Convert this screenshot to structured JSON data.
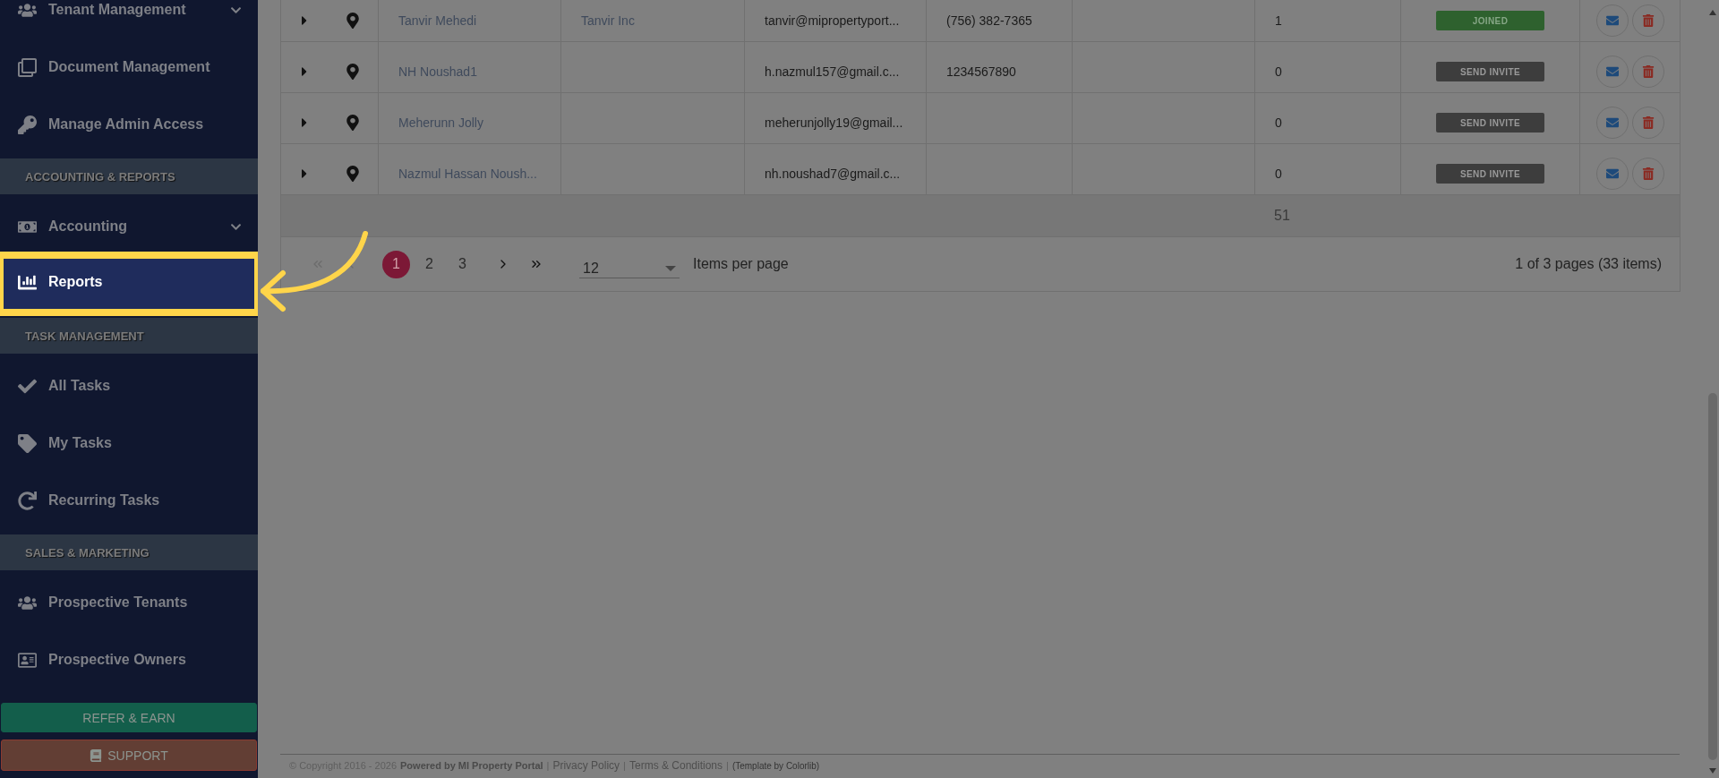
{
  "sidebar": {
    "items": [
      {
        "kind": "link",
        "label": "Tenant Management",
        "expandable": true,
        "selected": false
      },
      {
        "kind": "link",
        "label": "Document Management",
        "expandable": false,
        "selected": false
      },
      {
        "kind": "link",
        "label": "Manage Admin Access",
        "expandable": false,
        "selected": false
      },
      {
        "kind": "section",
        "label": "ACCOUNTING & REPORTS"
      },
      {
        "kind": "link",
        "label": "Accounting",
        "expandable": true,
        "selected": false
      },
      {
        "kind": "link",
        "label": "Reports",
        "expandable": false,
        "selected": true
      },
      {
        "kind": "section",
        "label": "TASK MANAGEMENT"
      },
      {
        "kind": "link",
        "label": "All Tasks",
        "expandable": false,
        "selected": false
      },
      {
        "kind": "link",
        "label": "My Tasks",
        "expandable": false,
        "selected": false
      },
      {
        "kind": "link",
        "label": "Recurring Tasks",
        "expandable": false,
        "selected": false
      },
      {
        "kind": "section",
        "label": "SALES & MARKETING"
      },
      {
        "kind": "link",
        "label": "Prospective Tenants",
        "expandable": false,
        "selected": false
      },
      {
        "kind": "link",
        "label": "Prospective Owners",
        "expandable": false,
        "selected": false
      }
    ],
    "refer_button": "REFER & EARN",
    "support_button": "SUPPORT"
  },
  "table": {
    "rows": [
      {
        "name": "Tanvir Mehedi",
        "company": "Tanvir Inc",
        "email": "tanvir@mipropertyport...",
        "phone": "(756) 382-7365",
        "count": "1",
        "status": {
          "kind": "joined",
          "label": "JOINED"
        }
      },
      {
        "name": "NH Noushad1",
        "company": "",
        "email": "h.nazmul157@gmail.c...",
        "phone": "1234567890",
        "count": "0",
        "status": {
          "kind": "invite",
          "label": "SEND INVITE"
        }
      },
      {
        "name": "Meherunn Jolly",
        "company": "",
        "email": "meherunjolly19@gmail...",
        "phone": "",
        "count": "0",
        "status": {
          "kind": "invite",
          "label": "SEND INVITE"
        }
      },
      {
        "name": "Nazmul Hassan Noush...",
        "company": "",
        "email": "nh.noushad7@gmail.c...",
        "phone": "",
        "count": "0",
        "status": {
          "kind": "invite",
          "label": "SEND INVITE"
        }
      }
    ],
    "total": "51"
  },
  "pager": {
    "nav_start": [
      {
        "kind": "first",
        "disabled": true
      },
      {
        "kind": "prev",
        "disabled": true
      }
    ],
    "pages": [
      {
        "label": "1",
        "selected": true
      },
      {
        "label": "2",
        "selected": false
      },
      {
        "label": "3",
        "selected": false
      }
    ],
    "nav_end": [
      {
        "kind": "next",
        "disabled": false
      },
      {
        "kind": "last",
        "disabled": false
      }
    ],
    "per_page": "12",
    "per_page_label": "Items per page",
    "info": "1 of 3 pages (33 items)"
  },
  "footer": {
    "copyright": "© Copyright 2016 - 2026",
    "powered": "Powered by MI Property Portal",
    "separator": "|",
    "links": [
      "Privacy Policy",
      "Terms & Conditions"
    ],
    "credit": "(Template by Colorlib)"
  }
}
